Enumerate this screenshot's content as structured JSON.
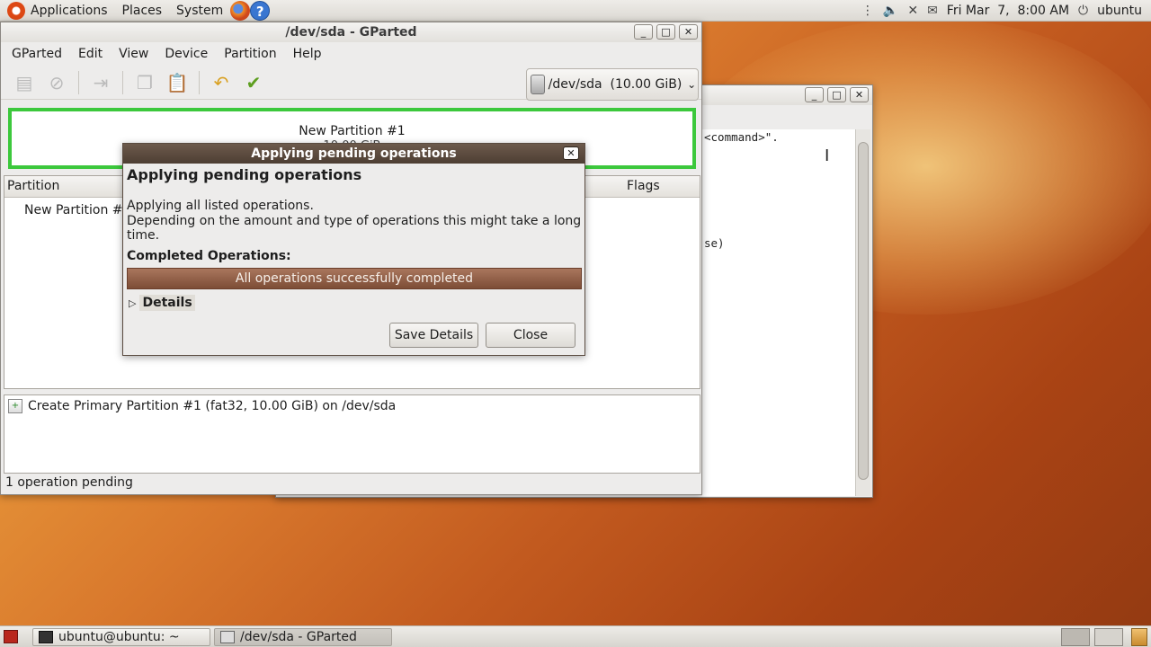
{
  "top_panel": {
    "menus": [
      "Applications",
      "Places",
      "System"
    ],
    "clock": "Fri Mar  7,  8:00 AM",
    "user": "ubuntu"
  },
  "terminal": {
    "lines": [
      "<command>\".",
      "se)"
    ]
  },
  "gparted": {
    "title": "/dev/sda - GParted",
    "menu": [
      "GParted",
      "Edit",
      "View",
      "Device",
      "Partition",
      "Help"
    ],
    "device": "/dev/sda  (10.00 GiB)",
    "partition_visual": {
      "label": "New Partition #1",
      "size": "10.00 GiB"
    },
    "columns": {
      "partition": "Partition",
      "flags": "Flags"
    },
    "rows": [
      {
        "partition": "New Partition #1"
      }
    ],
    "operations": [
      "Create Primary Partition #1 (fat32, 10.00 GiB) on /dev/sda"
    ],
    "status": "1 operation pending"
  },
  "dialog": {
    "title": "Applying pending operations",
    "heading": "Applying pending operations",
    "text1": "Applying all listed operations.",
    "text2": "Depending on the amount and type of operations this might take a long time.",
    "completed_label": "Completed Operations:",
    "progress_text": "All operations successfully completed",
    "progress": 1.0,
    "details_label": "Details",
    "save_button": "Save Details",
    "close_button": "Close"
  },
  "taskbar": {
    "tasks": [
      "ubuntu@ubuntu: ~",
      "/dev/sda - GParted"
    ]
  }
}
